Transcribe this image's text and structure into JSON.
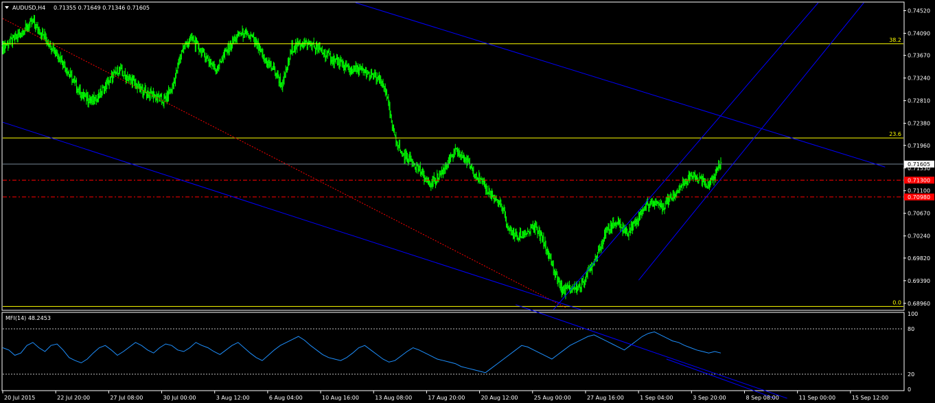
{
  "header": {
    "symbol_label": "AUDUSD,H4",
    "ohlc_label": "0.71355 0.71649 0.71346 0.71605"
  },
  "indicator": {
    "label": "MFI(14) 48.2453",
    "levels_shown": [
      "100",
      "80",
      "20",
      "0"
    ],
    "value": 48.2453
  },
  "colors": {
    "background": "#000000",
    "candle": "#00ff00",
    "fib_line": "#ffff00",
    "channel": "#0000ff",
    "indicator_line": "#1e90ff",
    "support_line": "#ff0000",
    "price_line": "#778899",
    "axis": "#ffffff"
  },
  "chart_data": [
    {
      "type": "line",
      "subtype": "candlestick-ohlc",
      "symbol": "AUDUSD",
      "timeframe": "H4",
      "current": {
        "open": 0.71355,
        "high": 0.71649,
        "low": 0.71346,
        "close": 0.71605
      },
      "ylim": [
        0.6884,
        0.7467
      ],
      "y_ticks": [
        "0.74520",
        "0.74090",
        "0.73670",
        "0.73240",
        "0.72810",
        "0.72380",
        "0.71960",
        "0.71530",
        "0.71100",
        "0.70670",
        "0.70240",
        "0.69820",
        "0.69390",
        "0.68960"
      ],
      "x_ticks": [
        "20 Jul 2015",
        "22 Jul 20:00",
        "27 Jul 08:00",
        "30 Jul 00:00",
        "3 Aug 12:00",
        "6 Aug 04:00",
        "10 Aug 16:00",
        "13 Aug 08:00",
        "17 Aug 20:00",
        "20 Aug 12:00",
        "25 Aug 00:00",
        "27 Aug 16:00",
        "1 Sep 04:00",
        "3 Sep 20:00",
        "8 Sep 08:00",
        "11 Sep 00:00",
        "15 Sep 12:00"
      ],
      "close_path": [
        [
          0,
          0.7385
        ],
        [
          3,
          0.7395
        ],
        [
          6,
          0.741
        ],
        [
          10,
          0.743
        ],
        [
          14,
          0.74
        ],
        [
          18,
          0.737
        ],
        [
          22,
          0.733
        ],
        [
          26,
          0.729
        ],
        [
          30,
          0.728
        ],
        [
          34,
          0.731
        ],
        [
          38,
          0.734
        ],
        [
          42,
          0.732
        ],
        [
          46,
          0.73
        ],
        [
          50,
          0.729
        ],
        [
          53,
          0.728
        ],
        [
          56,
          0.731
        ],
        [
          59,
          0.738
        ],
        [
          62,
          0.74
        ],
        [
          66,
          0.737
        ],
        [
          70,
          0.734
        ],
        [
          74,
          0.738
        ],
        [
          78,
          0.741
        ],
        [
          82,
          0.74
        ],
        [
          86,
          0.736
        ],
        [
          89,
          0.734
        ],
        [
          92,
          0.731
        ],
        [
          95,
          0.738
        ],
        [
          98,
          0.739
        ],
        [
          102,
          0.7385
        ],
        [
          106,
          0.737
        ],
        [
          110,
          0.7355
        ],
        [
          114,
          0.734
        ],
        [
          117,
          0.734
        ],
        [
          120,
          0.733
        ],
        [
          123,
          0.7325
        ],
        [
          126,
          0.73
        ],
        [
          128,
          0.723
        ],
        [
          131,
          0.718
        ],
        [
          134,
          0.717
        ],
        [
          137,
          0.715
        ],
        [
          140,
          0.712
        ],
        [
          143,
          0.7135
        ],
        [
          146,
          0.716
        ],
        [
          149,
          0.7185
        ],
        [
          152,
          0.717
        ],
        [
          155,
          0.7145
        ],
        [
          158,
          0.712
        ],
        [
          161,
          0.71
        ],
        [
          164,
          0.708
        ],
        [
          166,
          0.704
        ],
        [
          169,
          0.702
        ],
        [
          172,
          0.703
        ],
        [
          175,
          0.704
        ],
        [
          178,
          0.701
        ],
        [
          181,
          0.696
        ],
        [
          184,
          0.692
        ],
        [
          187,
          0.6925
        ],
        [
          190,
          0.693
        ],
        [
          193,
          0.696
        ],
        [
          196,
          0.7
        ],
        [
          199,
          0.704
        ],
        [
          202,
          0.705
        ],
        [
          205,
          0.703
        ],
        [
          208,
          0.705
        ],
        [
          211,
          0.708
        ],
        [
          214,
          0.709
        ],
        [
          217,
          0.708
        ],
        [
          220,
          0.71
        ],
        [
          223,
          0.712
        ],
        [
          226,
          0.714
        ],
        [
          229,
          0.713
        ],
        [
          232,
          0.712
        ],
        [
          234,
          0.714
        ],
        [
          236,
          0.716
        ]
      ],
      "horizontal_levels": [
        {
          "label": "38.2",
          "price": 0.7389
        },
        {
          "label": "23.6",
          "price": 0.721
        },
        {
          "label": "0.0",
          "price": 0.689
        },
        {
          "label": "0.71605",
          "price": 0.71605
        },
        {
          "label": "0.71300",
          "price": 0.713
        },
        {
          "label": "0.70980",
          "price": 0.7098
        }
      ],
      "grid": false
    },
    {
      "type": "line",
      "title": "MFI(14) 48.2453",
      "ylim": [
        0,
        100
      ],
      "y_ticks": [
        "100",
        "80",
        "20",
        "0"
      ],
      "levels": [
        80,
        20
      ],
      "values": [
        55,
        52,
        45,
        48,
        58,
        62,
        55,
        50,
        58,
        60,
        52,
        42,
        38,
        35,
        40,
        48,
        55,
        58,
        52,
        45,
        50,
        56,
        62,
        58,
        52,
        48,
        55,
        60,
        58,
        52,
        50,
        55,
        62,
        58,
        55,
        50,
        46,
        52,
        58,
        62,
        55,
        48,
        42,
        38,
        45,
        52,
        58,
        62,
        66,
        70,
        65,
        58,
        52,
        46,
        42,
        40,
        38,
        42,
        48,
        55,
        58,
        52,
        46,
        40,
        36,
        38,
        44,
        50,
        55,
        52,
        48,
        44,
        40,
        38,
        36,
        34,
        30,
        28,
        26,
        24,
        22,
        28,
        34,
        40,
        46,
        52,
        58,
        56,
        52,
        48,
        44,
        40,
        46,
        52,
        58,
        62,
        66,
        70,
        72,
        68,
        64,
        60,
        56,
        52,
        58,
        64,
        70,
        74,
        76,
        72,
        68,
        64,
        62,
        58,
        55,
        52,
        50,
        48,
        50,
        48
      ]
    }
  ]
}
